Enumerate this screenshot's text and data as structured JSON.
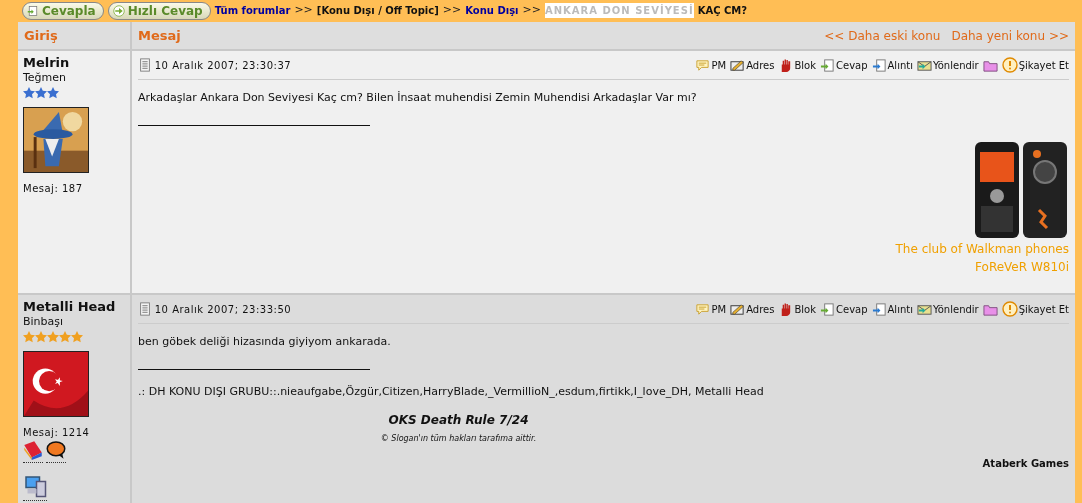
{
  "top_buttons": [
    {
      "label": "Cevapla",
      "kind": "reply"
    },
    {
      "label": "Hızlı Cevap",
      "kind": "quick"
    }
  ],
  "breadcrumb": [
    {
      "label": "Tüm forumlar",
      "kind": "link"
    },
    {
      "label": ">>",
      "kind": "sep"
    },
    {
      "label": "[Konu Dışı / Off Topic]",
      "kind": "text"
    },
    {
      "label": ">>",
      "kind": "sep"
    },
    {
      "label": "Konu Dışı",
      "kind": "link"
    },
    {
      "label": ">>",
      "kind": "sep"
    },
    {
      "label": "ANKARA DON SEVİYESİ",
      "kind": "highlight"
    },
    {
      "label": "KAÇ CM?",
      "kind": "text"
    }
  ],
  "header": {
    "column_1": "Giriş",
    "column_2": "Mesaj",
    "older": "<< Daha eski konu",
    "newer": "Daha yeni konu >>"
  },
  "posts": [
    {
      "author": "Melrin",
      "rank": "Teğmen",
      "stars": 3,
      "color": "#3a6fd0",
      "avatar": {
        "kind": "picture"
      },
      "post_count": "Mesaj: 187",
      "date": "10 Aralık 2007; 23:30:37",
      "actions": [
        {
          "kind": "pm",
          "label": "PM"
        },
        {
          "kind": "address",
          "label": "Adres"
        },
        {
          "kind": "block",
          "label": "Blok"
        },
        {
          "kind": "reply",
          "label": "Cevap"
        },
        {
          "kind": "quote",
          "label": "Alıntı"
        },
        {
          "kind": "forward",
          "label": "Yönlendir"
        },
        {
          "kind": "folder"
        },
        {
          "kind": "report",
          "label": "Şikayet Et"
        }
      ],
      "body": "Arkadaşlar Ankara Don Seviyesi Kaç cm? Bilen İnsaat muhendisi Zemin Muhendisi Arkadaşlar Var mı?",
      "signature": [
        {
          "kind": "picture"
        },
        {
          "kind": "orange",
          "text": "The club of Walkman phones"
        },
        {
          "kind": "orange",
          "text": "FoReVeR W810i"
        }
      ]
    },
    {
      "author": "Metalli Head",
      "rank": "Binbaşı",
      "stars": 5,
      "color": "#f0a020",
      "avatar": {
        "kind": "picture"
      },
      "post_count": "Mesaj: 1214",
      "extras": [
        {
          "kind": "book"
        },
        {
          "kind": "chat"
        },
        {
          "kind": "computer"
        }
      ],
      "date": "10 Aralık 2007; 23:33:50",
      "actions": [
        {
          "kind": "pm",
          "label": "PM"
        },
        {
          "kind": "address",
          "label": "Adres"
        },
        {
          "kind": "block",
          "label": "Blok"
        },
        {
          "kind": "reply",
          "label": "Cevap"
        },
        {
          "kind": "quote",
          "label": "Alıntı"
        },
        {
          "kind": "forward",
          "label": "Yönlendir"
        },
        {
          "kind": "folder"
        },
        {
          "kind": "report",
          "label": "Şikayet Et"
        }
      ],
      "body": "ben göbek deliği hizasında giyiyom ankarada.",
      "signature": [
        {
          "kind": "plain",
          "text": ".: DH KONU DIŞI GRUBU::.nieaufgabe,Özgür,Citizen,HarryBlade,_VermillioN_,esdum,firtikk,I_love_DH, Metalli Head"
        },
        {
          "kind": "title",
          "text": "OKS Death Rule 7/24"
        },
        {
          "kind": "note",
          "text": "© Slogan'ın tüm hakları tarafıma aittir."
        },
        {
          "kind": "credit",
          "text": "Ataberk Games"
        }
      ]
    }
  ]
}
